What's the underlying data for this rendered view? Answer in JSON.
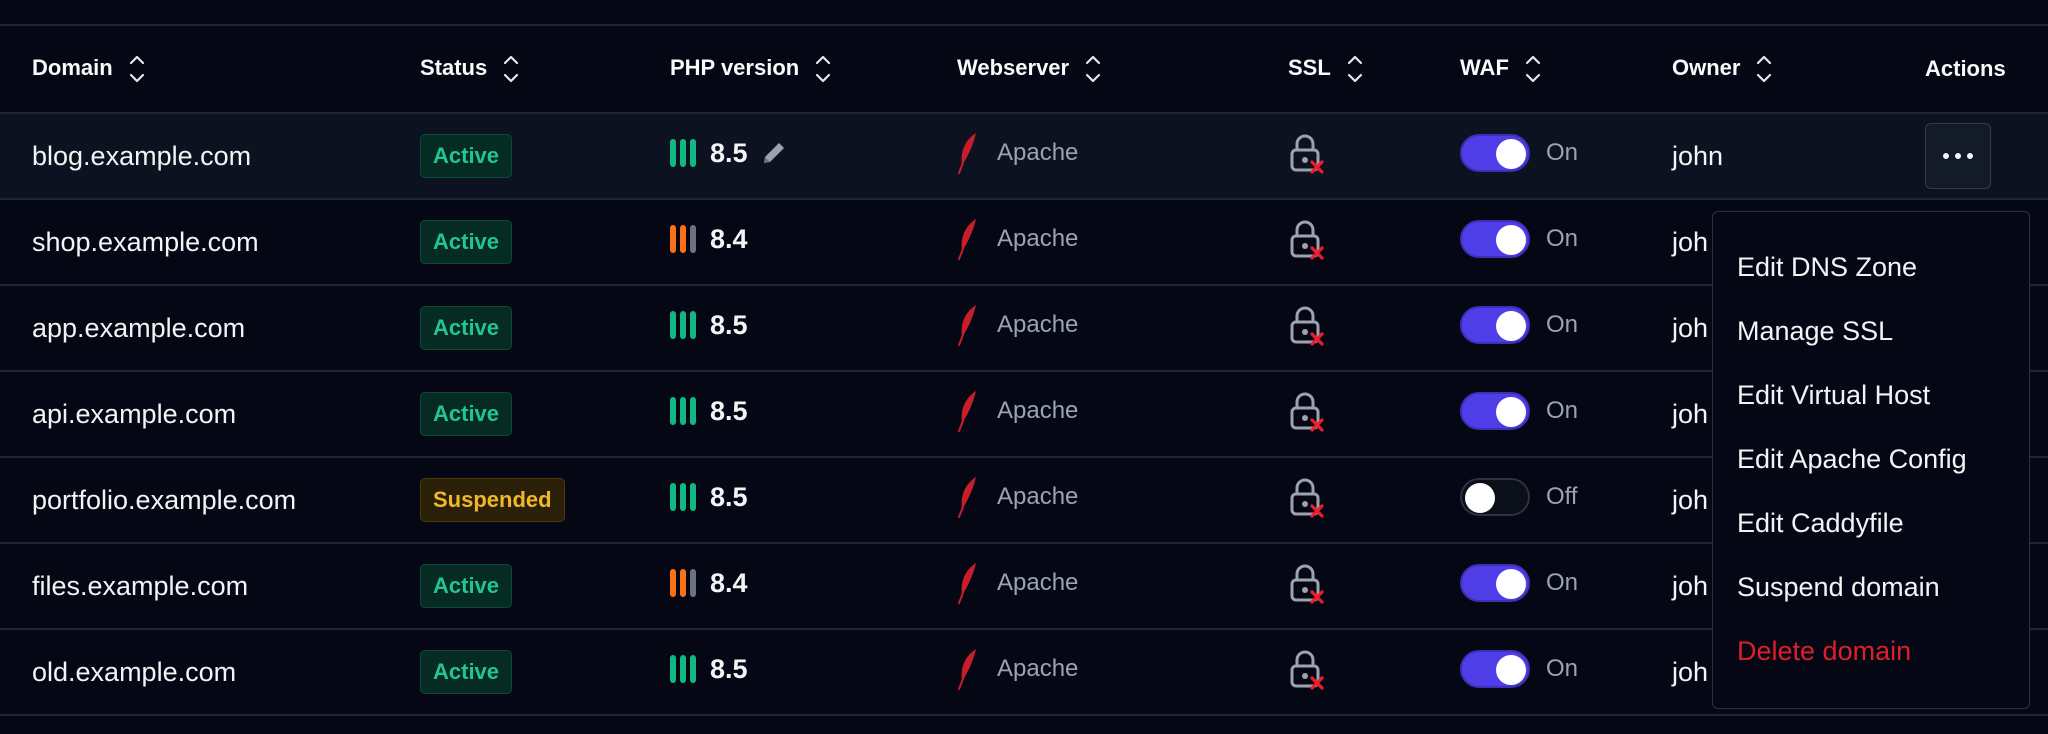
{
  "columns": {
    "domain": "Domain",
    "status": "Status",
    "php": "PHP version",
    "webserver": "Webserver",
    "ssl": "SSL",
    "waf": "WAF",
    "owner": "Owner",
    "actions": "Actions"
  },
  "rows": [
    {
      "domain": "blog.example.com",
      "status": "Active",
      "status_type": "active",
      "php_version": "8.5",
      "php_bars": [
        "#10b981",
        "#10b981",
        "#10b981"
      ],
      "webserver": "Apache",
      "ssl_icon": "lock-x-icon",
      "waf_on": true,
      "waf_label": "On",
      "owner": "john"
    },
    {
      "domain": "shop.example.com",
      "status": "Active",
      "status_type": "active",
      "php_version": "8.4",
      "php_bars": [
        "#f97316",
        "#f97316",
        "#6b7280"
      ],
      "webserver": "Apache",
      "ssl_icon": "lock-x-icon",
      "waf_on": true,
      "waf_label": "On",
      "owner": "joh"
    },
    {
      "domain": "app.example.com",
      "status": "Active",
      "status_type": "active",
      "php_version": "8.5",
      "php_bars": [
        "#10b981",
        "#10b981",
        "#10b981"
      ],
      "webserver": "Apache",
      "ssl_icon": "lock-x-icon",
      "waf_on": true,
      "waf_label": "On",
      "owner": "joh"
    },
    {
      "domain": "api.example.com",
      "status": "Active",
      "status_type": "active",
      "php_version": "8.5",
      "php_bars": [
        "#10b981",
        "#10b981",
        "#10b981"
      ],
      "webserver": "Apache",
      "ssl_icon": "lock-x-icon",
      "waf_on": true,
      "waf_label": "On",
      "owner": "joh"
    },
    {
      "domain": "portfolio.example.com",
      "status": "Suspended",
      "status_type": "suspended",
      "php_version": "8.5",
      "php_bars": [
        "#10b981",
        "#10b981",
        "#10b981"
      ],
      "webserver": "Apache",
      "ssl_icon": "lock-x-icon",
      "waf_on": false,
      "waf_label": "Off",
      "owner": "joh"
    },
    {
      "domain": "files.example.com",
      "status": "Active",
      "status_type": "active",
      "php_version": "8.4",
      "php_bars": [
        "#f97316",
        "#f97316",
        "#6b7280"
      ],
      "webserver": "Apache",
      "ssl_icon": "lock-x-icon",
      "waf_on": true,
      "waf_label": "On",
      "owner": "joh"
    },
    {
      "domain": "old.example.com",
      "status": "Active",
      "status_type": "active",
      "php_version": "8.5",
      "php_bars": [
        "#10b981",
        "#10b981",
        "#10b981"
      ],
      "webserver": "Apache",
      "ssl_icon": "lock-x-icon",
      "waf_on": true,
      "waf_label": "On",
      "owner": "joh"
    }
  ],
  "menu": [
    {
      "label": "Edit DNS Zone",
      "danger": false
    },
    {
      "label": "Manage SSL",
      "danger": false
    },
    {
      "label": "Edit Virtual Host",
      "danger": false
    },
    {
      "label": "Edit Apache Config",
      "danger": false
    },
    {
      "label": "Edit Caddyfile",
      "danger": false
    },
    {
      "label": "Suspend domain",
      "danger": false
    },
    {
      "label": "Delete domain",
      "danger": true
    }
  ],
  "colors": {
    "background": "#050814",
    "active": "#22c590",
    "suspended": "#f0b72c",
    "toggle_on": "#4f3ee8",
    "danger": "#e01e2a",
    "feather": "#c81e2a"
  }
}
